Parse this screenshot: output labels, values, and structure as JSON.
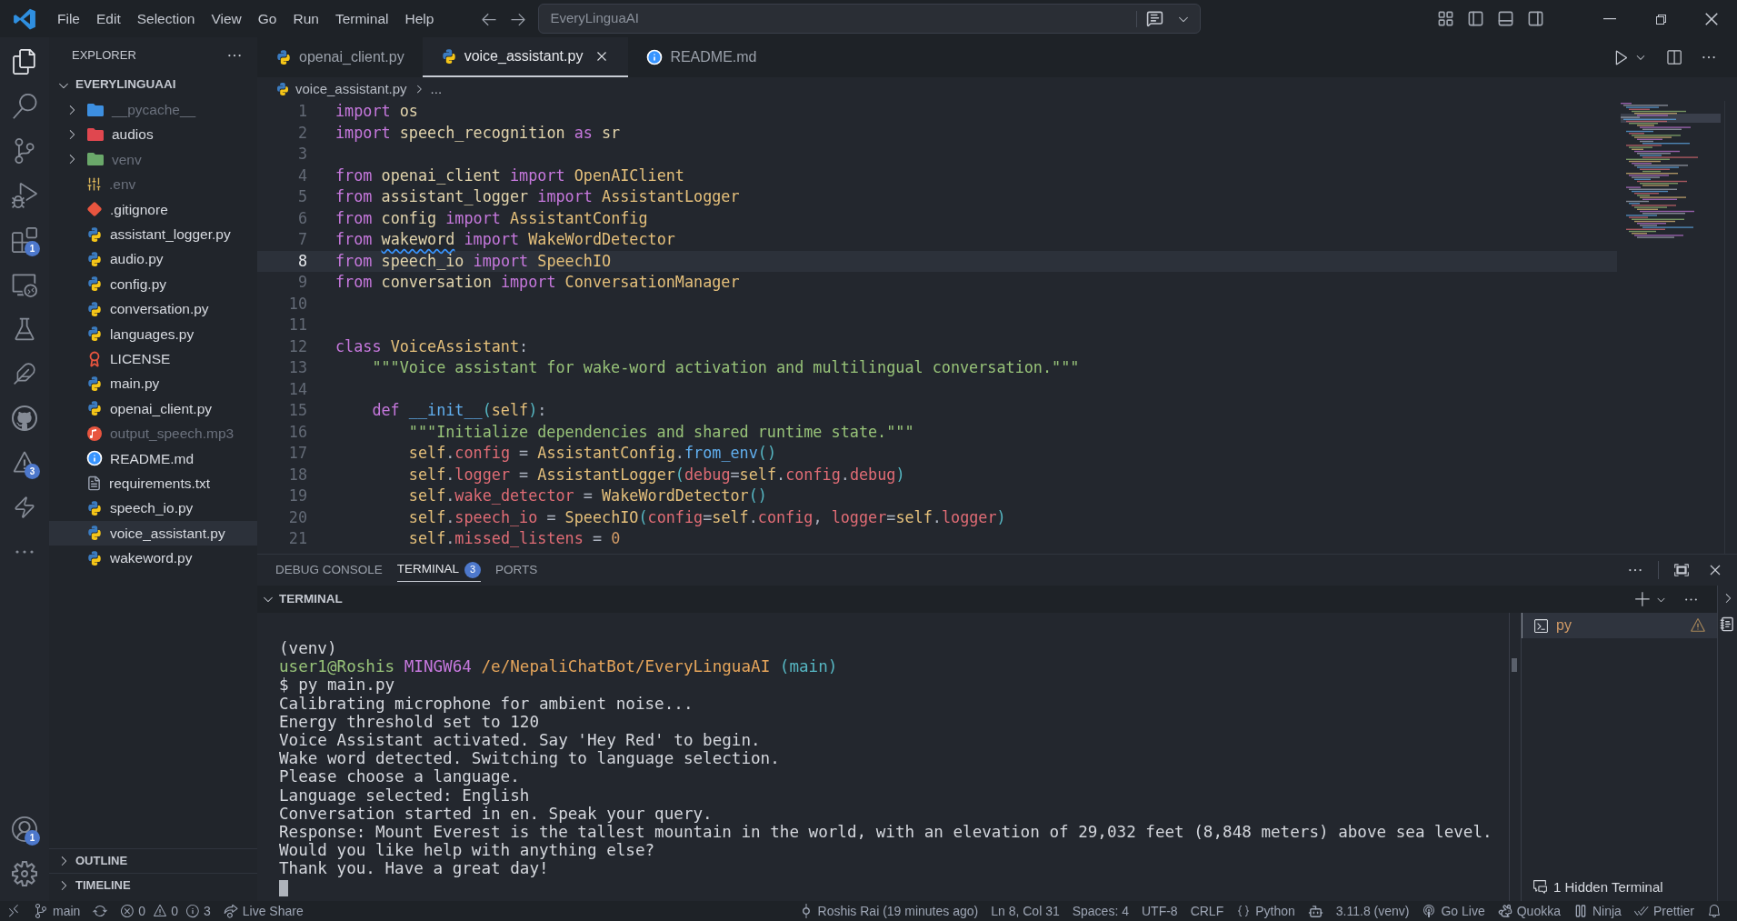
{
  "menu": [
    "File",
    "Edit",
    "Selection",
    "View",
    "Go",
    "Run",
    "Terminal",
    "Help"
  ],
  "command_center": "EveryLinguaAI",
  "activity_bar": [
    {
      "kind": "explorer",
      "selected": true
    },
    {
      "kind": "search",
      "selected": false
    },
    {
      "kind": "source_control",
      "selected": false
    },
    {
      "kind": "run_debug",
      "selected": false
    },
    {
      "kind": "extensions",
      "badge": "1",
      "selected": false
    },
    {
      "kind": "remote",
      "selected": false
    },
    {
      "kind": "testing",
      "selected": false
    },
    {
      "kind": "brush",
      "selected": false
    },
    {
      "kind": "github",
      "selected": false
    },
    {
      "kind": "problems",
      "badge": "3",
      "selected": false
    },
    {
      "kind": "lightning",
      "selected": false
    },
    {
      "kind": "more",
      "selected": false
    }
  ],
  "activity_bottom": [
    {
      "kind": "account",
      "badge": "1"
    },
    {
      "kind": "settings"
    }
  ],
  "explorer": {
    "title": "EXPLORER",
    "folder": "EVERYLINGUAAI",
    "items": [
      {
        "kind": "folder",
        "name": "__pycache__",
        "color": "#3d8fe0",
        "expanded": false,
        "ignored": true,
        "selected": false
      },
      {
        "kind": "folder",
        "name": "audios",
        "color": "#e0474f",
        "expanded": false,
        "ignored": false,
        "selected": false
      },
      {
        "kind": "folder",
        "name": "venv",
        "color": "#6aa86a",
        "expanded": false,
        "ignored": true,
        "selected": false
      },
      {
        "kind": "env",
        "name": ".env",
        "ignored": true,
        "selected": false
      },
      {
        "kind": "git",
        "name": ".gitignore",
        "ignored": false,
        "selected": false
      },
      {
        "kind": "python",
        "name": "assistant_logger.py",
        "ignored": false,
        "selected": false
      },
      {
        "kind": "python",
        "name": "audio.py",
        "ignored": false,
        "selected": false
      },
      {
        "kind": "python",
        "name": "config.py",
        "ignored": false,
        "selected": false
      },
      {
        "kind": "python",
        "name": "conversation.py",
        "ignored": false,
        "selected": false
      },
      {
        "kind": "python",
        "name": "languages.py",
        "ignored": false,
        "selected": false
      },
      {
        "kind": "license",
        "name": "LICENSE",
        "ignored": false,
        "selected": false
      },
      {
        "kind": "python",
        "name": "main.py",
        "ignored": false,
        "selected": false
      },
      {
        "kind": "python",
        "name": "openai_client.py",
        "ignored": false,
        "selected": false
      },
      {
        "kind": "audio",
        "name": "output_speech.mp3",
        "ignored": true,
        "selected": false
      },
      {
        "kind": "info",
        "name": "README.md",
        "ignored": false,
        "selected": false
      },
      {
        "kind": "text",
        "name": "requirements.txt",
        "ignored": false,
        "selected": false
      },
      {
        "kind": "python",
        "name": "speech_io.py",
        "ignored": false,
        "selected": false
      },
      {
        "kind": "python",
        "name": "voice_assistant.py",
        "ignored": false,
        "selected": true
      },
      {
        "kind": "python",
        "name": "wakeword.py",
        "ignored": false,
        "selected": false
      }
    ],
    "sections": [
      {
        "title": "OUTLINE",
        "expanded": false
      },
      {
        "title": "TIMELINE",
        "expanded": false
      }
    ]
  },
  "tabs": [
    {
      "kind": "python",
      "name": "openai_client.py",
      "selected": false
    },
    {
      "kind": "python",
      "name": "voice_assistant.py",
      "selected": true
    },
    {
      "kind": "info",
      "name": "README.md",
      "selected": false
    }
  ],
  "breadcrumb": [
    "voice_assistant.py",
    "..."
  ],
  "editor": {
    "lines": [
      {
        "number": "1",
        "current": false,
        "tokens": [
          {
            "kind": "kw",
            "text": "import "
          },
          {
            "kind": "mod",
            "text": "os"
          }
        ]
      },
      {
        "number": "2",
        "current": false,
        "tokens": [
          {
            "kind": "kw",
            "text": "import "
          },
          {
            "kind": "mod",
            "text": "speech_recognition "
          },
          {
            "kind": "kw",
            "text": "as "
          },
          {
            "kind": "mod",
            "text": "sr"
          }
        ]
      },
      {
        "number": "3",
        "current": false
      },
      {
        "number": "4",
        "current": false,
        "tokens": [
          {
            "kind": "kw",
            "text": "from "
          },
          {
            "kind": "mod",
            "text": "openai_client "
          },
          {
            "kind": "kw",
            "text": "import "
          },
          {
            "kind": "cls",
            "text": "OpenAIClient"
          }
        ]
      },
      {
        "number": "5",
        "current": false,
        "tokens": [
          {
            "kind": "kw",
            "text": "from "
          },
          {
            "kind": "mod",
            "text": "assistant_logger "
          },
          {
            "kind": "kw",
            "text": "import "
          },
          {
            "kind": "cls",
            "text": "AssistantLogger"
          }
        ]
      },
      {
        "number": "6",
        "current": false,
        "tokens": [
          {
            "kind": "kw",
            "text": "from "
          },
          {
            "kind": "mod",
            "text": "config "
          },
          {
            "kind": "kw",
            "text": "import "
          },
          {
            "kind": "cls",
            "text": "AssistantConfig"
          }
        ]
      },
      {
        "number": "7",
        "current": false,
        "tokens": [
          {
            "kind": "kw",
            "text": "from "
          },
          {
            "kind": "flagged",
            "text": "wakeword"
          },
          {
            "kind": "kw",
            "text": " import "
          },
          {
            "kind": "cls",
            "text": "WakeWordDetector"
          }
        ]
      },
      {
        "number": "8",
        "current": true,
        "tokens": [
          {
            "kind": "kw",
            "text": "from "
          },
          {
            "kind": "mod",
            "text": "speech_io "
          },
          {
            "kind": "kw",
            "text": "import "
          },
          {
            "kind": "cls",
            "text": "SpeechIO"
          }
        ]
      },
      {
        "number": "9",
        "current": false,
        "tokens": [
          {
            "kind": "kw",
            "text": "from "
          },
          {
            "kind": "mod",
            "text": "conversation "
          },
          {
            "kind": "kw",
            "text": "import "
          },
          {
            "kind": "cls",
            "text": "ConversationManager"
          }
        ]
      },
      {
        "number": "10",
        "current": false
      },
      {
        "number": "11",
        "current": false
      },
      {
        "number": "12",
        "current": false,
        "tokens": [
          {
            "kind": "kw",
            "text": "class "
          },
          {
            "kind": "cls",
            "text": "VoiceAssistant"
          },
          {
            "kind": "plain",
            "text": ":"
          }
        ]
      },
      {
        "number": "13",
        "current": false,
        "tokens": [
          {
            "kind": "str",
            "text": "    \"\"\"Voice assistant for wake-word activation and multilingual conversation.\"\"\""
          }
        ]
      },
      {
        "number": "14",
        "current": false
      },
      {
        "number": "15",
        "current": false,
        "tokens": [
          {
            "kind": "kw",
            "text": "    def "
          },
          {
            "kind": "func",
            "text": "__init__"
          },
          {
            "kind": "bracket",
            "text": "("
          },
          {
            "kind": "self",
            "text": "self"
          },
          {
            "kind": "bracket",
            "text": ")"
          },
          {
            "kind": "plain",
            "text": ":"
          }
        ]
      },
      {
        "number": "16",
        "current": false,
        "tokens": [
          {
            "kind": "str",
            "text": "        \"\"\"Initialize dependencies and shared runtime state.\"\"\""
          }
        ]
      },
      {
        "number": "17",
        "current": false,
        "tokens": [
          {
            "kind": "self",
            "text": "        self"
          },
          {
            "kind": "plain",
            "text": "."
          },
          {
            "kind": "attr",
            "text": "config"
          },
          {
            "kind": "plain",
            "text": " = "
          },
          {
            "kind": "cls",
            "text": "AssistantConfig"
          },
          {
            "kind": "plain",
            "text": "."
          },
          {
            "kind": "func",
            "text": "from_env"
          },
          {
            "kind": "bracket",
            "text": "()"
          }
        ]
      },
      {
        "number": "18",
        "current": false,
        "tokens": [
          {
            "kind": "self",
            "text": "        self"
          },
          {
            "kind": "plain",
            "text": "."
          },
          {
            "kind": "attr",
            "text": "logger"
          },
          {
            "kind": "plain",
            "text": " = "
          },
          {
            "kind": "cls",
            "text": "AssistantLogger"
          },
          {
            "kind": "bracket",
            "text": "("
          },
          {
            "kind": "attr",
            "text": "debug"
          },
          {
            "kind": "plain",
            "text": "="
          },
          {
            "kind": "self",
            "text": "self"
          },
          {
            "kind": "plain",
            "text": "."
          },
          {
            "kind": "attr",
            "text": "config"
          },
          {
            "kind": "plain",
            "text": "."
          },
          {
            "kind": "attr",
            "text": "debug"
          },
          {
            "kind": "bracket",
            "text": ")"
          }
        ]
      },
      {
        "number": "19",
        "current": false,
        "tokens": [
          {
            "kind": "self",
            "text": "        self"
          },
          {
            "kind": "plain",
            "text": "."
          },
          {
            "kind": "attr",
            "text": "wake_detector"
          },
          {
            "kind": "plain",
            "text": " = "
          },
          {
            "kind": "cls",
            "text": "WakeWordDetector"
          },
          {
            "kind": "bracket",
            "text": "()"
          }
        ]
      },
      {
        "number": "20",
        "current": false,
        "tokens": [
          {
            "kind": "self",
            "text": "        self"
          },
          {
            "kind": "plain",
            "text": "."
          },
          {
            "kind": "attr",
            "text": "speech_io"
          },
          {
            "kind": "plain",
            "text": " = "
          },
          {
            "kind": "cls",
            "text": "SpeechIO"
          },
          {
            "kind": "bracket",
            "text": "("
          },
          {
            "kind": "attr",
            "text": "config"
          },
          {
            "kind": "plain",
            "text": "="
          },
          {
            "kind": "self",
            "text": "self"
          },
          {
            "kind": "plain",
            "text": "."
          },
          {
            "kind": "attr",
            "text": "config"
          },
          {
            "kind": "plain",
            "text": ", "
          },
          {
            "kind": "attr",
            "text": "logger"
          },
          {
            "kind": "plain",
            "text": "="
          },
          {
            "kind": "self",
            "text": "self"
          },
          {
            "kind": "plain",
            "text": "."
          },
          {
            "kind": "attr",
            "text": "logger"
          },
          {
            "kind": "bracket",
            "text": ")"
          }
        ]
      },
      {
        "number": "21",
        "current": false,
        "tokens": [
          {
            "kind": "self",
            "text": "        self"
          },
          {
            "kind": "plain",
            "text": "."
          },
          {
            "kind": "attr",
            "text": "missed_listens"
          },
          {
            "kind": "plain",
            "text": " = "
          },
          {
            "kind": "num",
            "text": "0"
          }
        ]
      }
    ]
  },
  "panel": {
    "tabs": [
      {
        "label": "DEBUG CONSOLE",
        "selected": false
      },
      {
        "label": "TERMINAL",
        "badge": "3",
        "selected": true
      },
      {
        "label": "PORTS",
        "selected": false
      }
    ],
    "section": "TERMINAL",
    "terminal_lines": [
      {
        "segments": [
          {
            "kind": "plain",
            "text": "(venv)"
          }
        ]
      },
      {
        "segments": [
          {
            "kind": "user",
            "text": "user1@Roshis "
          },
          {
            "kind": "host",
            "text": "MINGW64 "
          },
          {
            "kind": "path",
            "text": "/e/NepaliChatBot/EveryLinguaAI "
          },
          {
            "kind": "branch",
            "text": "(main)"
          }
        ]
      },
      {
        "segments": [
          {
            "kind": "plain",
            "text": "$ py main.py"
          }
        ]
      },
      {
        "segments": [
          {
            "kind": "plain",
            "text": "Calibrating microphone for ambient noise..."
          }
        ]
      },
      {
        "segments": [
          {
            "kind": "plain",
            "text": "Energy threshold set to 120"
          }
        ]
      },
      {
        "segments": [
          {
            "kind": "plain",
            "text": "Voice Assistant activated. Say 'Hey Red' to begin."
          }
        ]
      },
      {
        "segments": [
          {
            "kind": "plain",
            "text": "Wake word detected. Switching to language selection."
          }
        ]
      },
      {
        "segments": [
          {
            "kind": "plain",
            "text": "Please choose a language."
          }
        ]
      },
      {
        "segments": [
          {
            "kind": "plain",
            "text": "Language selected: English"
          }
        ]
      },
      {
        "segments": [
          {
            "kind": "plain",
            "text": "Conversation started in en. Speak your query."
          }
        ]
      },
      {
        "segments": [
          {
            "kind": "plain",
            "text": "Response: Mount Everest is the tallest mountain in the world, with an elevation of 29,032 feet (8,848 meters) above sea level."
          }
        ]
      },
      {
        "segments": [
          {
            "kind": "plain",
            "text": "Would you like help with anything else?"
          }
        ]
      },
      {
        "segments": [
          {
            "kind": "plain",
            "text": "Thank you. Have a great day!"
          }
        ]
      }
    ],
    "cursor_visible": true,
    "terminals": [
      {
        "name": "py",
        "warning": true,
        "selected": true
      }
    ],
    "hidden_terminals": "1 Hidden Terminal"
  },
  "status_left": [
    {
      "kind": "remote"
    },
    {
      "kind": "branch",
      "text": "main"
    },
    {
      "kind": "sync"
    },
    {
      "kind": "problems",
      "errors": "0",
      "warnings": "0",
      "infos": "3"
    },
    {
      "kind": "liveshare",
      "text": "Live Share"
    }
  ],
  "status_right": [
    {
      "kind": "commit",
      "text": "Roshis Rai (19 minutes ago)"
    },
    {
      "kind": "plain",
      "text": "Ln 8, Col 31"
    },
    {
      "kind": "plain",
      "text": "Spaces: 4"
    },
    {
      "kind": "plain",
      "text": "UTF-8"
    },
    {
      "kind": "plain",
      "text": "CRLF"
    },
    {
      "kind": "language",
      "text": "Python"
    },
    {
      "kind": "copilot"
    },
    {
      "kind": "plain",
      "text": "3.11.8 (venv)"
    },
    {
      "kind": "golive",
      "text": "Go Live"
    },
    {
      "kind": "quokka",
      "text": "Quokka"
    },
    {
      "kind": "ninja",
      "text": "Ninja"
    },
    {
      "kind": "prettier",
      "text": "Prettier"
    },
    {
      "kind": "bell"
    }
  ]
}
